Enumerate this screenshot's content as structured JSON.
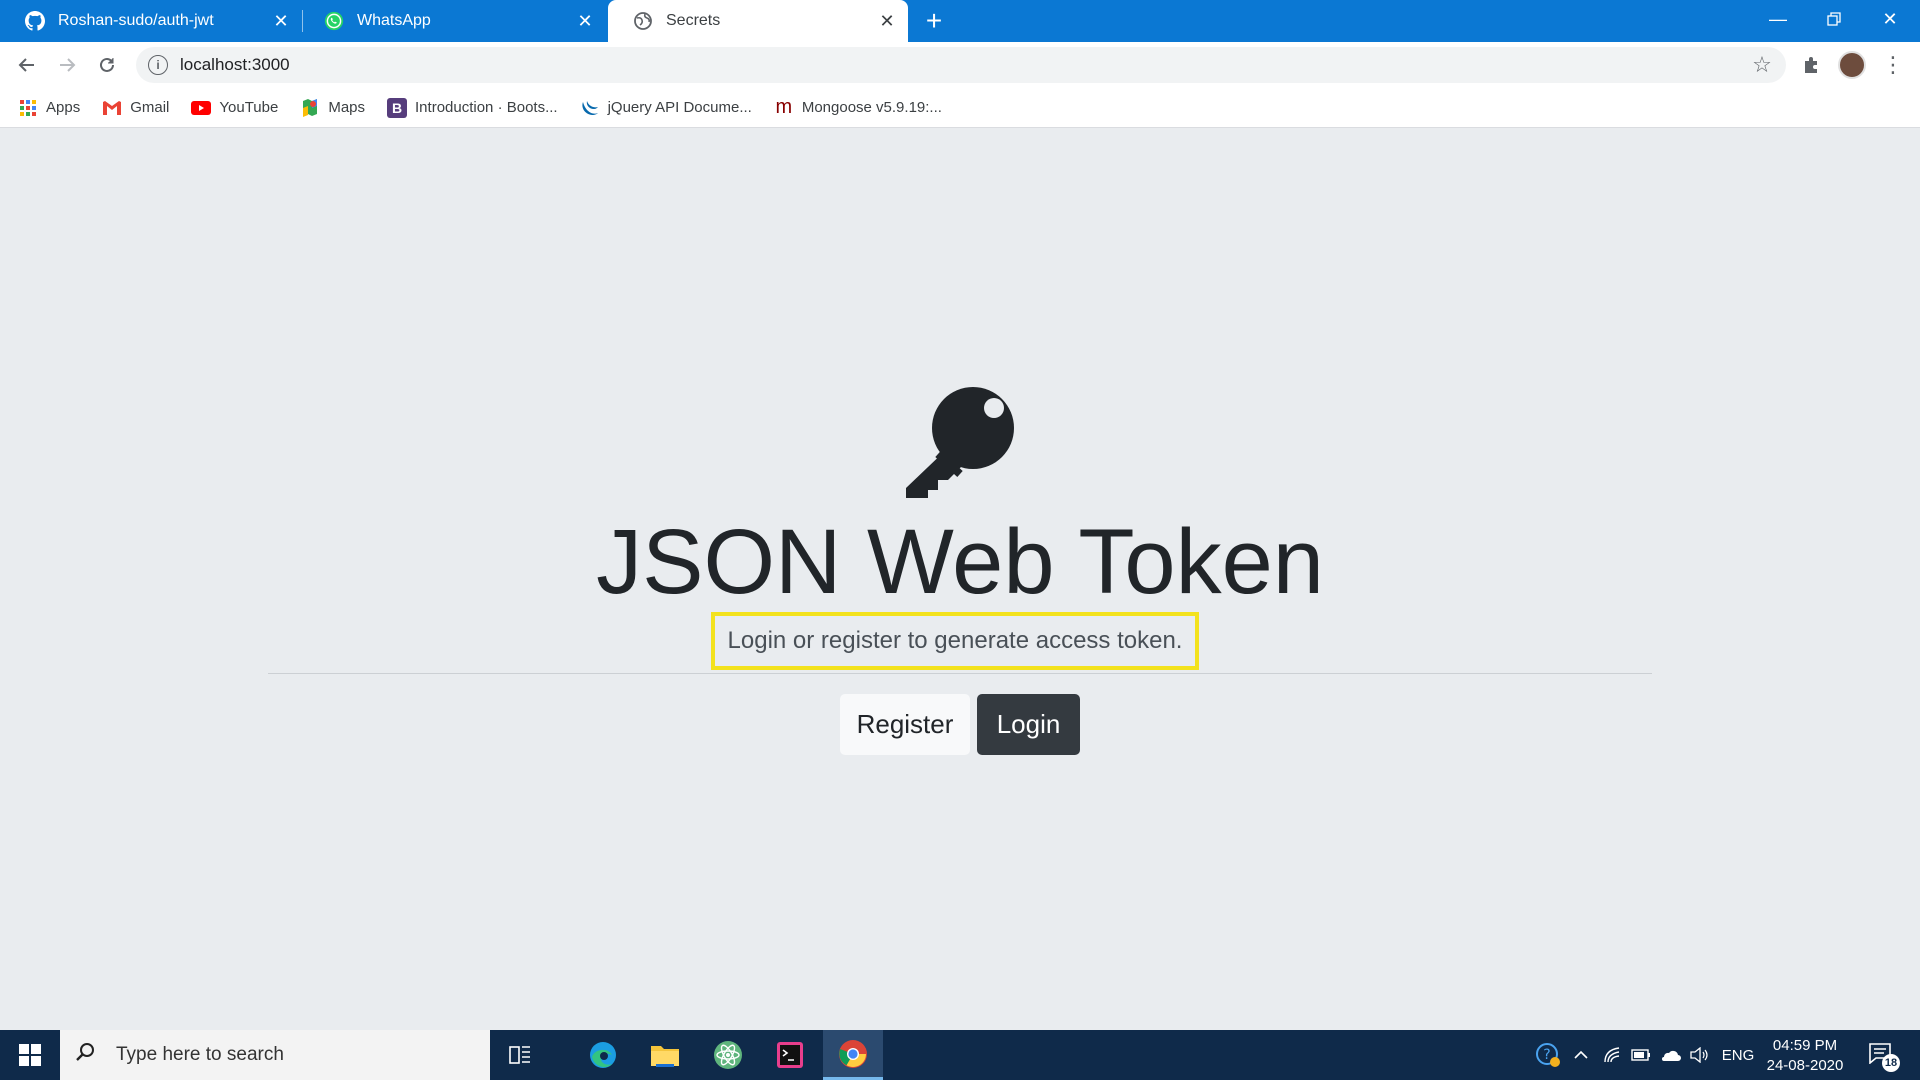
{
  "browser": {
    "tabs": [
      {
        "title": "Roshan-sudo/auth-jwt",
        "icon": "github-icon",
        "active": false
      },
      {
        "title": "WhatsApp",
        "icon": "whatsapp-icon",
        "active": false
      },
      {
        "title": "Secrets",
        "icon": "globe-icon",
        "active": true
      }
    ],
    "address": "localhost:3000",
    "bookmarks": [
      {
        "label": "Apps",
        "icon": "apps-grid-icon"
      },
      {
        "label": "Gmail",
        "icon": "gmail-icon"
      },
      {
        "label": "YouTube",
        "icon": "youtube-icon"
      },
      {
        "label": "Maps",
        "icon": "maps-icon"
      },
      {
        "label": "Introduction · Boots...",
        "icon": "bootstrap-icon"
      },
      {
        "label": "jQuery API Docume...",
        "icon": "jquery-icon"
      },
      {
        "label": "Mongoose v5.9.19:...",
        "icon": "mongoose-icon"
      }
    ]
  },
  "page": {
    "title": "JSON Web Token",
    "lead": "Login or register to generate access token.",
    "register_label": "Register",
    "login_label": "Login",
    "icon": "key-icon"
  },
  "taskbar": {
    "search_placeholder": "Type here to search",
    "language": "ENG",
    "time": "04:59 PM",
    "date": "24-08-2020",
    "notification_count": "18"
  },
  "colors": {
    "tabstrip": "#0b78d3",
    "page_bg": "#e9ecef",
    "highlight": "#f3e21d",
    "dark_button": "#343a40",
    "taskbar": "#0f2a4a"
  }
}
